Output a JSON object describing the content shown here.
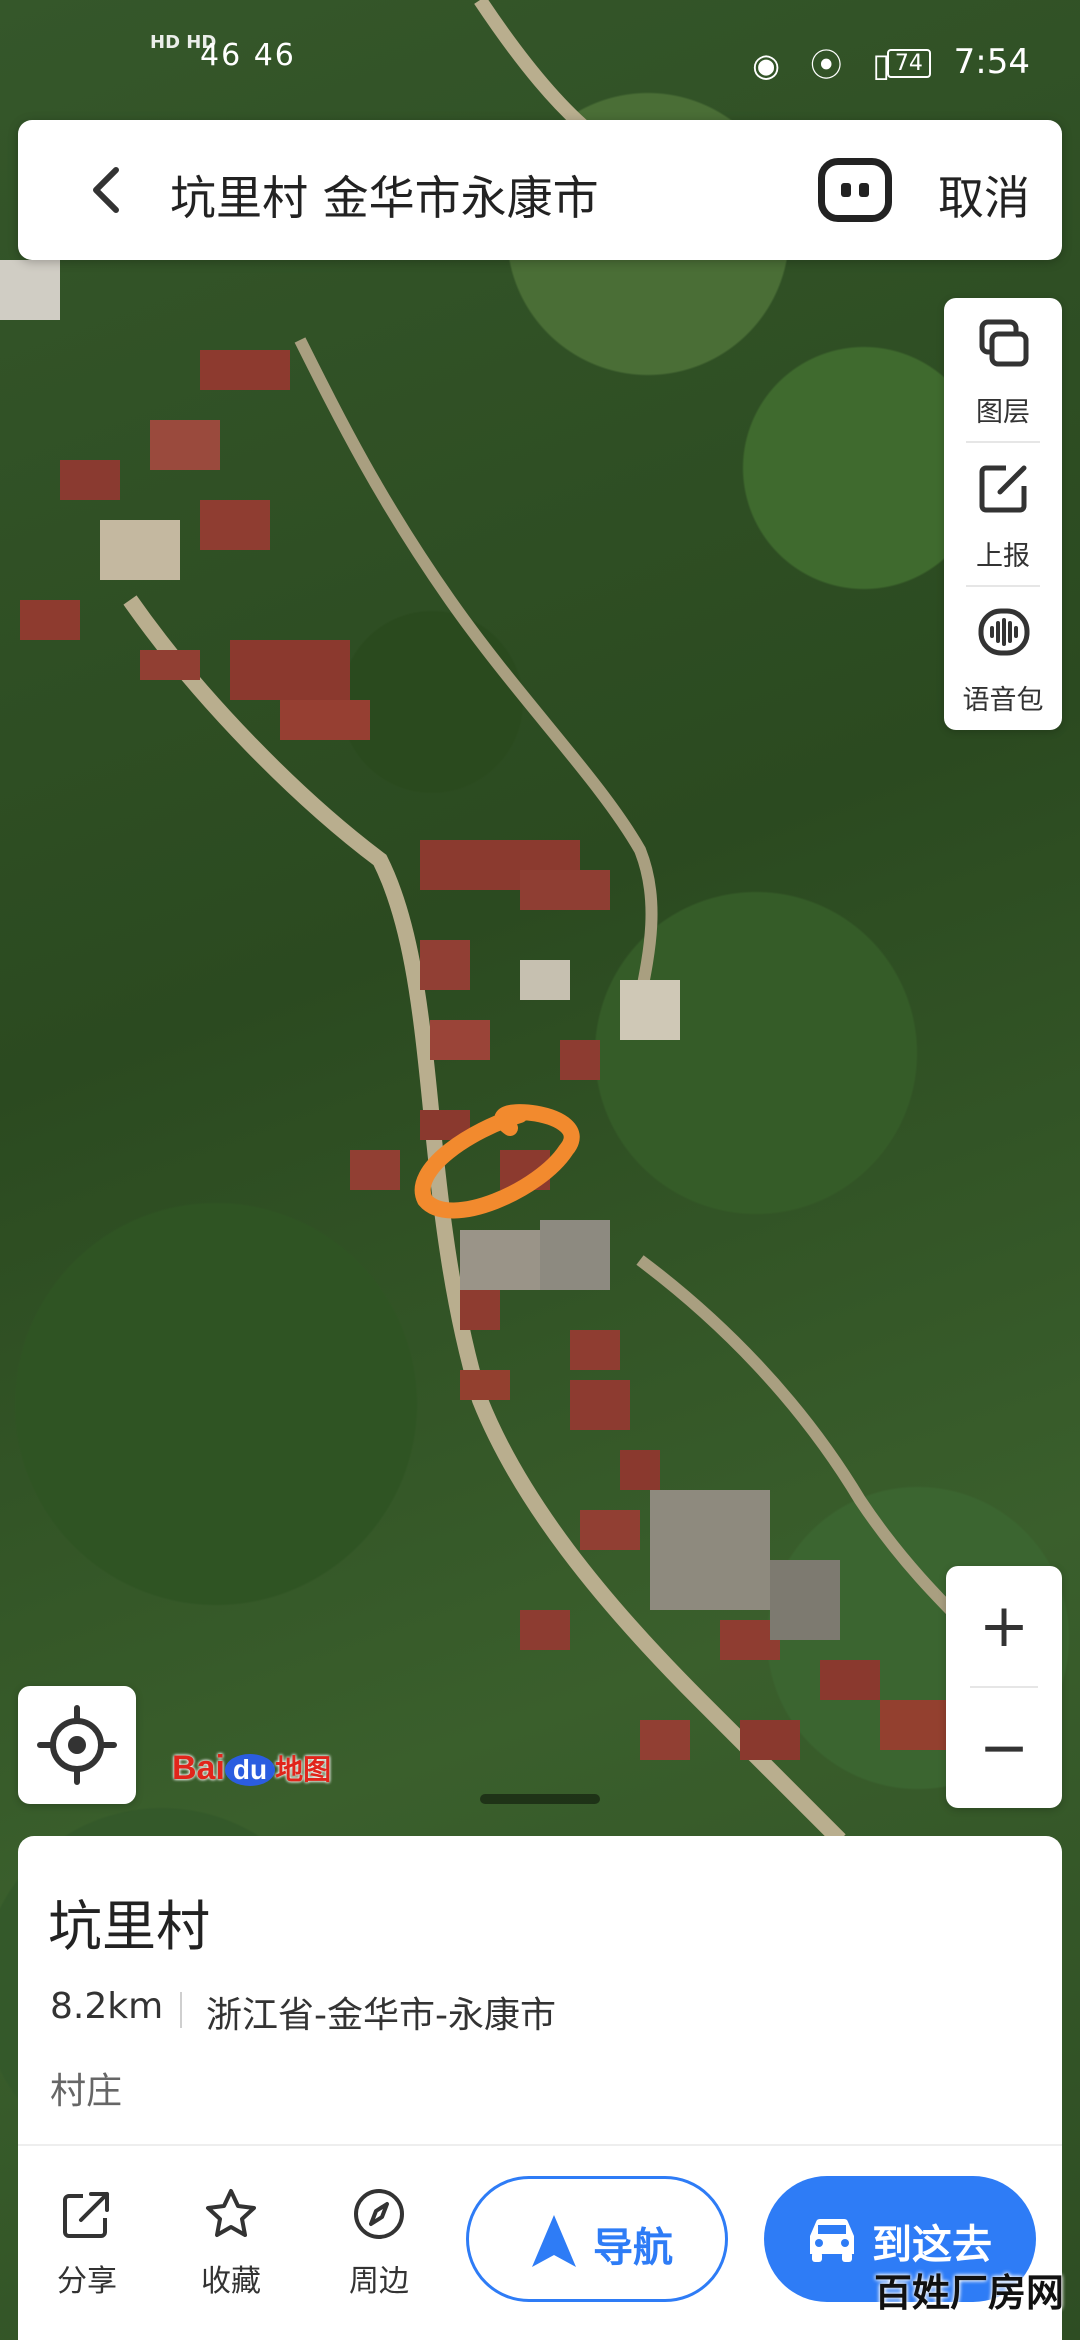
{
  "status_bar": {
    "left_tags": "HD HD",
    "signal": "46 46",
    "battery": "74",
    "time": "7:54"
  },
  "header": {
    "back_icon": "chevron-left-icon",
    "search_title": "坑里村 金华市永康市",
    "voice_icon": "voice-assistant-icon",
    "cancel_label": "取消"
  },
  "tools": [
    {
      "label": "图层",
      "icon": "layers-icon"
    },
    {
      "label": "上报",
      "icon": "report-edit-icon"
    },
    {
      "label": "语音包",
      "icon": "voice-pack-icon"
    }
  ],
  "zoom": {
    "in": "+",
    "out": "−"
  },
  "logo": {
    "bai": "Bai",
    "du": "du",
    "map": "地图"
  },
  "place": {
    "name": "坑里村",
    "distance": "8.2km",
    "address": "浙江省-金华市-永康市",
    "category": "村庄"
  },
  "actions": [
    {
      "label": "分享",
      "icon": "share-icon"
    },
    {
      "label": "收藏",
      "icon": "star-icon"
    },
    {
      "label": "周边",
      "icon": "compass-icon"
    }
  ],
  "navigate": {
    "label": "导航",
    "icon": "navigation-arrow-icon"
  },
  "go_there": {
    "label": "到这去",
    "icon": "car-icon"
  },
  "watermark": "百姓厂房网",
  "colors": {
    "accent": "#2e7cf6",
    "annotation": "#f28a2e",
    "logo_red": "#e1251b"
  }
}
